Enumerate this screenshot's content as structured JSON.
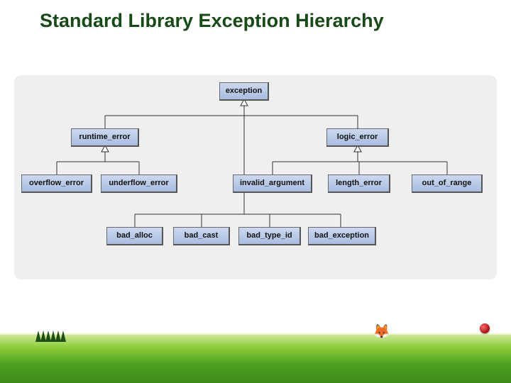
{
  "title": "Standard Library Exception Hierarchy",
  "colors": {
    "title": "#184a18",
    "panel_bg": "#efefef",
    "node_fill_top": "#ccd8ef",
    "node_fill_bottom": "#a9bde0",
    "node_border": "#6a6a6a"
  },
  "chart_data": {
    "type": "hierarchy_diagram",
    "nodes": {
      "exception": {
        "label": "exception",
        "row": 0
      },
      "runtime_error": {
        "label": "runtime_error",
        "row": 1,
        "parent": "exception"
      },
      "logic_error": {
        "label": "logic_error",
        "row": 1,
        "parent": "exception"
      },
      "overflow_error": {
        "label": "overflow_error",
        "row": 2,
        "parent": "runtime_error"
      },
      "underflow_error": {
        "label": "underflow_error",
        "row": 2,
        "parent": "runtime_error"
      },
      "invalid_argument": {
        "label": "invalid_argument",
        "row": 2,
        "parent": "logic_error"
      },
      "length_error": {
        "label": "length_error",
        "row": 2,
        "parent": "logic_error"
      },
      "out_of_range": {
        "label": "out_of_range",
        "row": 2,
        "parent": "logic_error"
      },
      "bad_alloc": {
        "label": "bad_alloc",
        "row": 3,
        "parent": "exception"
      },
      "bad_cast": {
        "label": "bad_cast",
        "row": 3,
        "parent": "exception"
      },
      "bad_type_id": {
        "label": "bad_type_id",
        "row": 3,
        "parent": "exception"
      },
      "bad_exception": {
        "label": "bad_exception",
        "row": 3,
        "parent": "exception"
      }
    }
  }
}
